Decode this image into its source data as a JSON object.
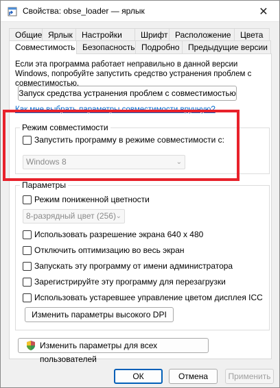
{
  "window": {
    "title": "Свойства: obse_loader — ярлык",
    "close_label": "✕"
  },
  "tabs_row1": [
    "Общие",
    "Ярлык",
    "Настройки",
    "Шрифт",
    "Расположение",
    "Цвета"
  ],
  "tabs_row2": [
    "Совместимость",
    "Безопасность",
    "Подробно",
    "Предыдущие версии"
  ],
  "active_tab": "Совместимость",
  "compat": {
    "intro": "Если эта программа работает неправильно в данной версии Windows, попробуйте запустить средство устранения проблем с совместимостью.",
    "troubleshoot_button": "Запуск средства устранения проблем с совместимостью",
    "manual_link": "Как мне выбрать параметры совместимости вручную?",
    "mode_group_title": "Режим совместимости",
    "mode_checkbox_label": "Запустить программу в режиме совместимости с:",
    "mode_combo_value": "Windows 8",
    "params_group_title": "Параметры",
    "reduced_color_label": "Режим пониженной цветности",
    "color_combo_value": "8-разрядный цвет (256)",
    "res640_label": "Использовать разрешение экрана 640 x 480",
    "disable_fullscreen_label": "Отключить оптимизацию во весь экран",
    "run_admin_label": "Запускать эту программу от имени администратора",
    "register_restart_label": "Зарегистрируйте эту программу для перезагрузки",
    "legacy_icc_label": "Использовать устаревшее управление цветом дисплея ICC",
    "dpi_button": "Изменить параметры высокого DPI",
    "all_users_button": "Изменить параметры для всех пользователей"
  },
  "footer": {
    "ok": "ОК",
    "cancel": "Отмена",
    "apply": "Применить"
  },
  "colors": {
    "accent": "#005fb8",
    "highlight": "#e8212b",
    "link": "#0066cc"
  }
}
